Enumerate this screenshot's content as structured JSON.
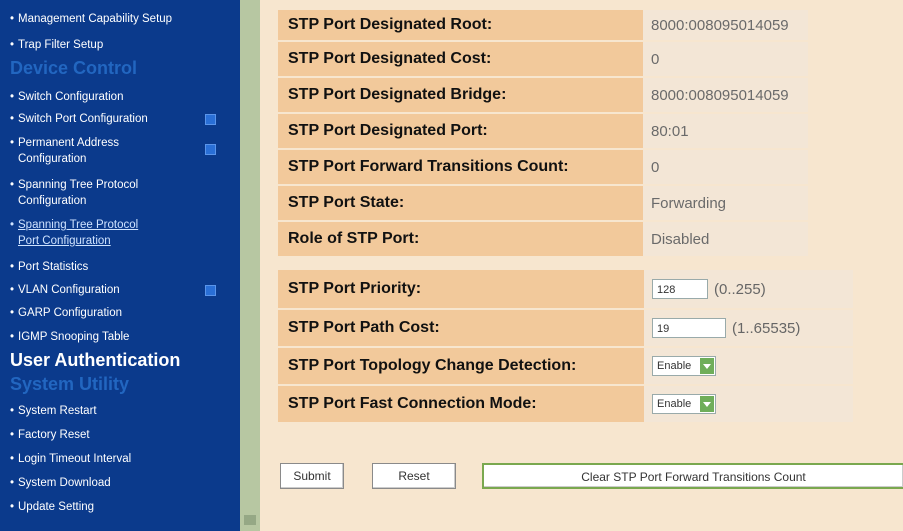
{
  "sidebar": {
    "items_top": [
      {
        "label": "Management Capability Setup"
      },
      {
        "label": "Trap Filter Setup"
      }
    ],
    "section_device_control": "Device Control",
    "device_items": [
      {
        "label": "Switch Configuration"
      },
      {
        "label": "Switch Port Configuration"
      },
      {
        "label": "Permanent Address"
      },
      {
        "label": "Configuration"
      },
      {
        "label": "Spanning Tree Protocol"
      },
      {
        "label": "Configuration"
      },
      {
        "label": "Spanning Tree Protocol"
      },
      {
        "label": "Port Configuration"
      },
      {
        "label": "Port Statistics"
      },
      {
        "label": "VLAN Configuration"
      },
      {
        "label": "GARP Configuration"
      },
      {
        "label": "IGMP Snooping Table"
      }
    ],
    "section_user_auth": "User Authentication",
    "section_system_utility": "System Utility",
    "utility_items": [
      {
        "label": "System Restart"
      },
      {
        "label": "Factory Reset"
      },
      {
        "label": "Login Timeout Interval"
      },
      {
        "label": "System Download"
      },
      {
        "label": "Update Setting"
      }
    ]
  },
  "status_rows": [
    {
      "label": "STP Port Designated Root:",
      "value": "8000:008095014059"
    },
    {
      "label": "STP Port Designated Cost:",
      "value": "0"
    },
    {
      "label": "STP Port Designated Bridge:",
      "value": "8000:008095014059"
    },
    {
      "label": "STP Port Designated Port:",
      "value": "80:01"
    },
    {
      "label": "STP Port Forward Transitions Count:",
      "value": "0"
    },
    {
      "label": "STP Port State:",
      "value": "Forwarding"
    },
    {
      "label": "Role of STP Port:",
      "value": "Disabled"
    }
  ],
  "config_rows": {
    "priority": {
      "label": "STP Port Priority:",
      "value": "128",
      "range": "(0..255)"
    },
    "path_cost": {
      "label": "STP Port Path Cost:",
      "value": "19",
      "range": "(1..65535)"
    },
    "topology": {
      "label": "STP Port Topology Change Detection:",
      "selected": "Enable"
    },
    "fast_conn": {
      "label": "STP Port Fast Connection Mode:",
      "selected": "Enable"
    }
  },
  "buttons": {
    "submit": "Submit",
    "reset": "Reset",
    "clear": "Clear STP Port Forward Transitions Count"
  }
}
